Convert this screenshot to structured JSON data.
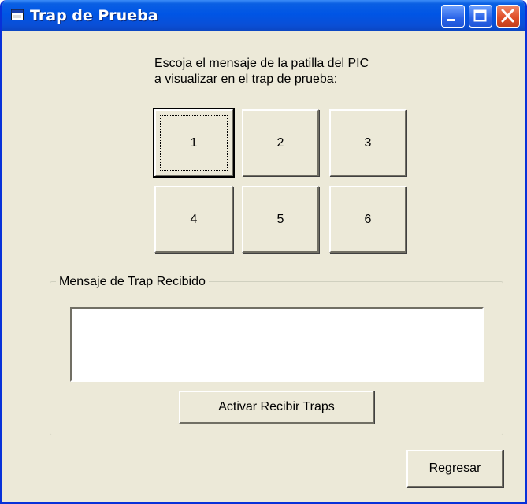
{
  "window": {
    "title": "Trap de Prueba",
    "controls": [
      "minimize-icon",
      "maximize-icon",
      "close-icon"
    ]
  },
  "instructions": {
    "line1": "Escoja el mensaje de la patilla del PIC",
    "line2": "a visualizar en el trap de prueba:"
  },
  "pin_buttons": [
    {
      "label": "1",
      "focused": true
    },
    {
      "label": "2"
    },
    {
      "label": "3"
    },
    {
      "label": "4"
    },
    {
      "label": "5"
    },
    {
      "label": "6"
    }
  ],
  "trap_group": {
    "legend": "Mensaje de Trap Recibido",
    "message_value": "",
    "activate_label": "Activar Recibir Traps"
  },
  "back_label": "Regresar",
  "colors": {
    "titlebar": "#0055e5",
    "window_face": "#ece9d8",
    "close_button": "#e0502a"
  }
}
